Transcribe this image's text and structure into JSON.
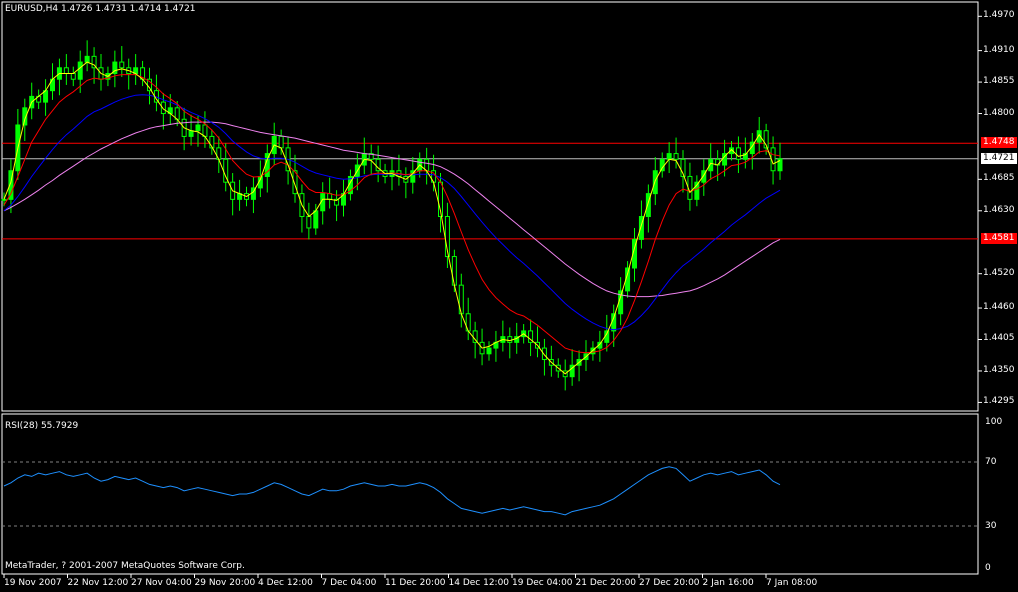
{
  "header": {
    "title": "EURUSD,H4  1.4726 1.4731 1.4714 1.4721"
  },
  "indicator": {
    "title": "RSI(28) 55.7929"
  },
  "footer": {
    "copyright": "MetaTrader, ? 2001-2007 MetaQuotes Software Corp."
  },
  "colors": {
    "background": "#000000",
    "frame": "#ffffff",
    "candle": "#00ff00",
    "ma_fast": "#ffff00",
    "ma_red": "#ff0000",
    "ma_blue": "#0000ff",
    "ma_violet": "#ee82ee",
    "rsi": "#1e90ff",
    "hline": "#ff0000",
    "bid": "#c0c0c0",
    "level": "#808080"
  },
  "chart_data": [
    {
      "type": "candlestick",
      "symbol": "EURUSD",
      "timeframe": "H4",
      "last_ohlc": [
        1.4726,
        1.4731,
        1.4714,
        1.4721
      ],
      "ylim": [
        1.428,
        1.4995
      ],
      "y_ticks": [
        "1.4970",
        "1.4910",
        "1.4855",
        "1.4800",
        "1.4685",
        "1.4630",
        "1.4520",
        "1.4460",
        "1.4405",
        "1.4350",
        "1.4295"
      ],
      "x_ticks": [
        "19 Nov 2007",
        "22 Nov 12:00",
        "27 Nov 04:00",
        "29 Nov 20:00",
        "4 Dec 12:00",
        "7 Dec 04:00",
        "11 Dec 20:00",
        "14 Dec 12:00",
        "19 Dec 04:00",
        "21 Dec 20:00",
        "27 Dec 20:00",
        "2 Jan 16:00",
        "7 Jan 08:00"
      ],
      "horizontal_lines": [
        {
          "value": 1.4748,
          "label": "1.4748"
        },
        {
          "value": 1.4581,
          "label": "1.4581"
        }
      ],
      "bid": {
        "value": 1.4721,
        "label": "1.4721"
      },
      "close_series": [
        1.465,
        1.47,
        1.478,
        1.481,
        1.483,
        1.482,
        1.484,
        1.486,
        1.488,
        1.487,
        1.486,
        1.489,
        1.49,
        1.488,
        1.486,
        1.487,
        1.489,
        1.488,
        1.487,
        1.488,
        1.486,
        1.484,
        1.482,
        1.48,
        1.481,
        1.479,
        1.476,
        1.477,
        1.478,
        1.476,
        1.474,
        1.472,
        1.468,
        1.465,
        1.466,
        1.465,
        1.467,
        1.469,
        1.473,
        1.476,
        1.474,
        1.47,
        1.466,
        1.462,
        1.46,
        1.463,
        1.466,
        1.465,
        1.464,
        1.466,
        1.469,
        1.471,
        1.473,
        1.472,
        1.47,
        1.469,
        1.47,
        1.469,
        1.468,
        1.47,
        1.472,
        1.47,
        1.468,
        1.462,
        1.455,
        1.45,
        1.445,
        1.442,
        1.44,
        1.438,
        1.439,
        1.44,
        1.441,
        1.44,
        1.441,
        1.442,
        1.44,
        1.439,
        1.437,
        1.436,
        1.435,
        1.434,
        1.436,
        1.437,
        1.438,
        1.439,
        1.44,
        1.442,
        1.445,
        1.449,
        1.453,
        1.458,
        1.462,
        1.466,
        1.47,
        1.472,
        1.473,
        1.472,
        1.469,
        1.465,
        1.468,
        1.47,
        1.472,
        1.471,
        1.473,
        1.474,
        1.472,
        1.473,
        1.475,
        1.477,
        1.474,
        1.47,
        1.4721
      ],
      "ma_yellow": [
        1.465,
        1.468,
        1.474,
        1.479,
        1.482,
        1.483,
        1.484,
        1.486,
        1.487,
        1.487,
        1.487,
        1.488,
        1.489,
        1.4885,
        1.487,
        1.4865,
        1.4875,
        1.4878,
        1.4875,
        1.487,
        1.486,
        1.4845,
        1.4825,
        1.4808,
        1.48,
        1.479,
        1.4775,
        1.477,
        1.4768,
        1.476,
        1.4742,
        1.472,
        1.469,
        1.4665,
        1.466,
        1.4655,
        1.4663,
        1.4685,
        1.472,
        1.4745,
        1.474,
        1.471,
        1.4675,
        1.464,
        1.462,
        1.463,
        1.465,
        1.465,
        1.4648,
        1.4658,
        1.468,
        1.47,
        1.472,
        1.4718,
        1.4705,
        1.4695,
        1.4695,
        1.469,
        1.4685,
        1.4695,
        1.471,
        1.47,
        1.468,
        1.463,
        1.456,
        1.45,
        1.445,
        1.442,
        1.4405,
        1.439,
        1.4393,
        1.44,
        1.4405,
        1.4403,
        1.4407,
        1.4415,
        1.4405,
        1.4395,
        1.4378,
        1.4365,
        1.4355,
        1.4345,
        1.4355,
        1.4365,
        1.4375,
        1.4386,
        1.4397,
        1.4415,
        1.4443,
        1.448,
        1.452,
        1.4565,
        1.4605,
        1.4645,
        1.4683,
        1.4705,
        1.472,
        1.4718,
        1.4695,
        1.4662,
        1.4675,
        1.4692,
        1.4713,
        1.471,
        1.4725,
        1.4737,
        1.4725,
        1.4728,
        1.4743,
        1.4763,
        1.4745,
        1.4712,
        1.4718
      ],
      "ma_red": [
        1.464,
        1.466,
        1.469,
        1.472,
        1.475,
        1.477,
        1.479,
        1.4805,
        1.482,
        1.483,
        1.4838,
        1.4848,
        1.4858,
        1.4862,
        1.486,
        1.4862,
        1.4866,
        1.4868,
        1.4868,
        1.4868,
        1.4863,
        1.4856,
        1.4846,
        1.4834,
        1.4826,
        1.4817,
        1.4804,
        1.4796,
        1.479,
        1.4782,
        1.4771,
        1.4757,
        1.4738,
        1.4718,
        1.4705,
        1.4694,
        1.4689,
        1.469,
        1.4698,
        1.471,
        1.4715,
        1.471,
        1.4698,
        1.4682,
        1.4668,
        1.4662,
        1.4662,
        1.466,
        1.4657,
        1.4658,
        1.4665,
        1.4675,
        1.4688,
        1.4694,
        1.4696,
        1.4695,
        1.4696,
        1.4695,
        1.4693,
        1.4695,
        1.47,
        1.47,
        1.4696,
        1.468,
        1.4655,
        1.4625,
        1.4593,
        1.4562,
        1.4535,
        1.451,
        1.4492,
        1.4478,
        1.4467,
        1.4457,
        1.445,
        1.4446,
        1.4438,
        1.443,
        1.442,
        1.441,
        1.44,
        1.439,
        1.4386,
        1.4383,
        1.4382,
        1.4383,
        1.4385,
        1.4391,
        1.4403,
        1.442,
        1.4443,
        1.4473,
        1.4506,
        1.4542,
        1.458,
        1.4612,
        1.464,
        1.466,
        1.4668,
        1.4664,
        1.4668,
        1.4675,
        1.4686,
        1.4692,
        1.47,
        1.4709,
        1.4711,
        1.4715,
        1.4723,
        1.4733,
        1.4735,
        1.4728,
        1.4726
      ],
      "ma_blue": [
        1.463,
        1.464,
        1.4655,
        1.4672,
        1.469,
        1.4706,
        1.4722,
        1.4737,
        1.4751,
        1.4763,
        1.4773,
        1.4784,
        1.4795,
        1.4803,
        1.4808,
        1.4814,
        1.482,
        1.4825,
        1.4829,
        1.4832,
        1.4833,
        1.4832,
        1.4829,
        1.4824,
        1.482,
        1.4815,
        1.4808,
        1.4802,
        1.4797,
        1.4791,
        1.4784,
        1.4776,
        1.4765,
        1.4752,
        1.4742,
        1.4733,
        1.4726,
        1.4722,
        1.4721,
        1.4722,
        1.4722,
        1.472,
        1.4715,
        1.4708,
        1.4701,
        1.4696,
        1.4693,
        1.469,
        1.4687,
        1.4685,
        1.4686,
        1.4688,
        1.4691,
        1.4693,
        1.4694,
        1.4694,
        1.4694,
        1.4694,
        1.4693,
        1.4693,
        1.4694,
        1.4694,
        1.4693,
        1.4688,
        1.468,
        1.4669,
        1.4655,
        1.464,
        1.4625,
        1.461,
        1.4596,
        1.4583,
        1.4571,
        1.4559,
        1.4548,
        1.4538,
        1.4527,
        1.4516,
        1.4504,
        1.4492,
        1.448,
        1.4468,
        1.4458,
        1.4449,
        1.4441,
        1.4434,
        1.4428,
        1.4424,
        1.4422,
        1.4424,
        1.4428,
        1.4436,
        1.4447,
        1.446,
        1.4476,
        1.4492,
        1.4508,
        1.4522,
        1.4534,
        1.4543,
        1.4553,
        1.4563,
        1.4574,
        1.4584,
        1.4594,
        1.4605,
        1.4614,
        1.4623,
        1.4633,
        1.4643,
        1.4652,
        1.4659,
        1.4666
      ],
      "ma_violet": [
        1.463,
        1.4636,
        1.4643,
        1.465,
        1.4658,
        1.4666,
        1.4675,
        1.4683,
        1.4692,
        1.47,
        1.4708,
        1.4716,
        1.4724,
        1.4731,
        1.4738,
        1.4744,
        1.475,
        1.4756,
        1.4761,
        1.4766,
        1.477,
        1.4774,
        1.4777,
        1.4779,
        1.4781,
        1.4783,
        1.4784,
        1.4785,
        1.4785,
        1.4785,
        1.4785,
        1.4784,
        1.4782,
        1.4779,
        1.4776,
        1.4773,
        1.477,
        1.4767,
        1.4765,
        1.4763,
        1.4761,
        1.4759,
        1.4757,
        1.4754,
        1.4751,
        1.4748,
        1.4745,
        1.4742,
        1.4739,
        1.4736,
        1.4734,
        1.4732,
        1.473,
        1.4729,
        1.4727,
        1.4725,
        1.4723,
        1.4721,
        1.4719,
        1.4717,
        1.4715,
        1.4713,
        1.4711,
        1.4707,
        1.4701,
        1.4694,
        1.4686,
        1.4677,
        1.4667,
        1.4657,
        1.4647,
        1.4637,
        1.4627,
        1.4617,
        1.4607,
        1.4597,
        1.4587,
        1.4577,
        1.4567,
        1.4557,
        1.4547,
        1.4537,
        1.4528,
        1.4519,
        1.4511,
        1.4503,
        1.4496,
        1.449,
        1.4486,
        1.4483,
        1.4481,
        1.448,
        1.448,
        1.448,
        1.4481,
        1.4482,
        1.4484,
        1.4486,
        1.4488,
        1.449,
        1.4494,
        1.4499,
        1.4505,
        1.4511,
        1.4518,
        1.4526,
        1.4534,
        1.4542,
        1.455,
        1.4558,
        1.4566,
        1.4574,
        1.458
      ]
    },
    {
      "type": "line",
      "indicator": "RSI(28)",
      "ylim": [
        0,
        100
      ],
      "y_ticks": [
        "100",
        "70",
        "30",
        "0"
      ],
      "levels": [
        70,
        30
      ],
      "values": [
        55,
        57,
        60,
        62,
        61,
        63,
        62,
        63,
        64,
        62,
        61,
        62,
        63,
        60,
        58,
        59,
        61,
        60,
        59,
        60,
        58,
        56,
        55,
        54,
        55,
        54,
        52,
        53,
        54,
        53,
        52,
        51,
        50,
        49,
        50,
        50,
        51,
        53,
        55,
        57,
        56,
        54,
        52,
        50,
        49,
        51,
        53,
        52,
        52,
        53,
        55,
        56,
        57,
        56,
        55,
        55,
        56,
        55,
        55,
        56,
        57,
        56,
        54,
        51,
        47,
        44,
        41,
        40,
        39,
        38,
        39,
        40,
        41,
        40,
        41,
        42,
        41,
        40,
        39,
        39,
        38,
        37,
        39,
        40,
        41,
        42,
        43,
        45,
        47,
        50,
        53,
        56,
        59,
        62,
        64,
        66,
        67,
        66,
        62,
        58,
        60,
        62,
        63,
        62,
        63,
        64,
        62,
        63,
        64,
        65,
        62,
        58,
        55.79
      ]
    }
  ]
}
